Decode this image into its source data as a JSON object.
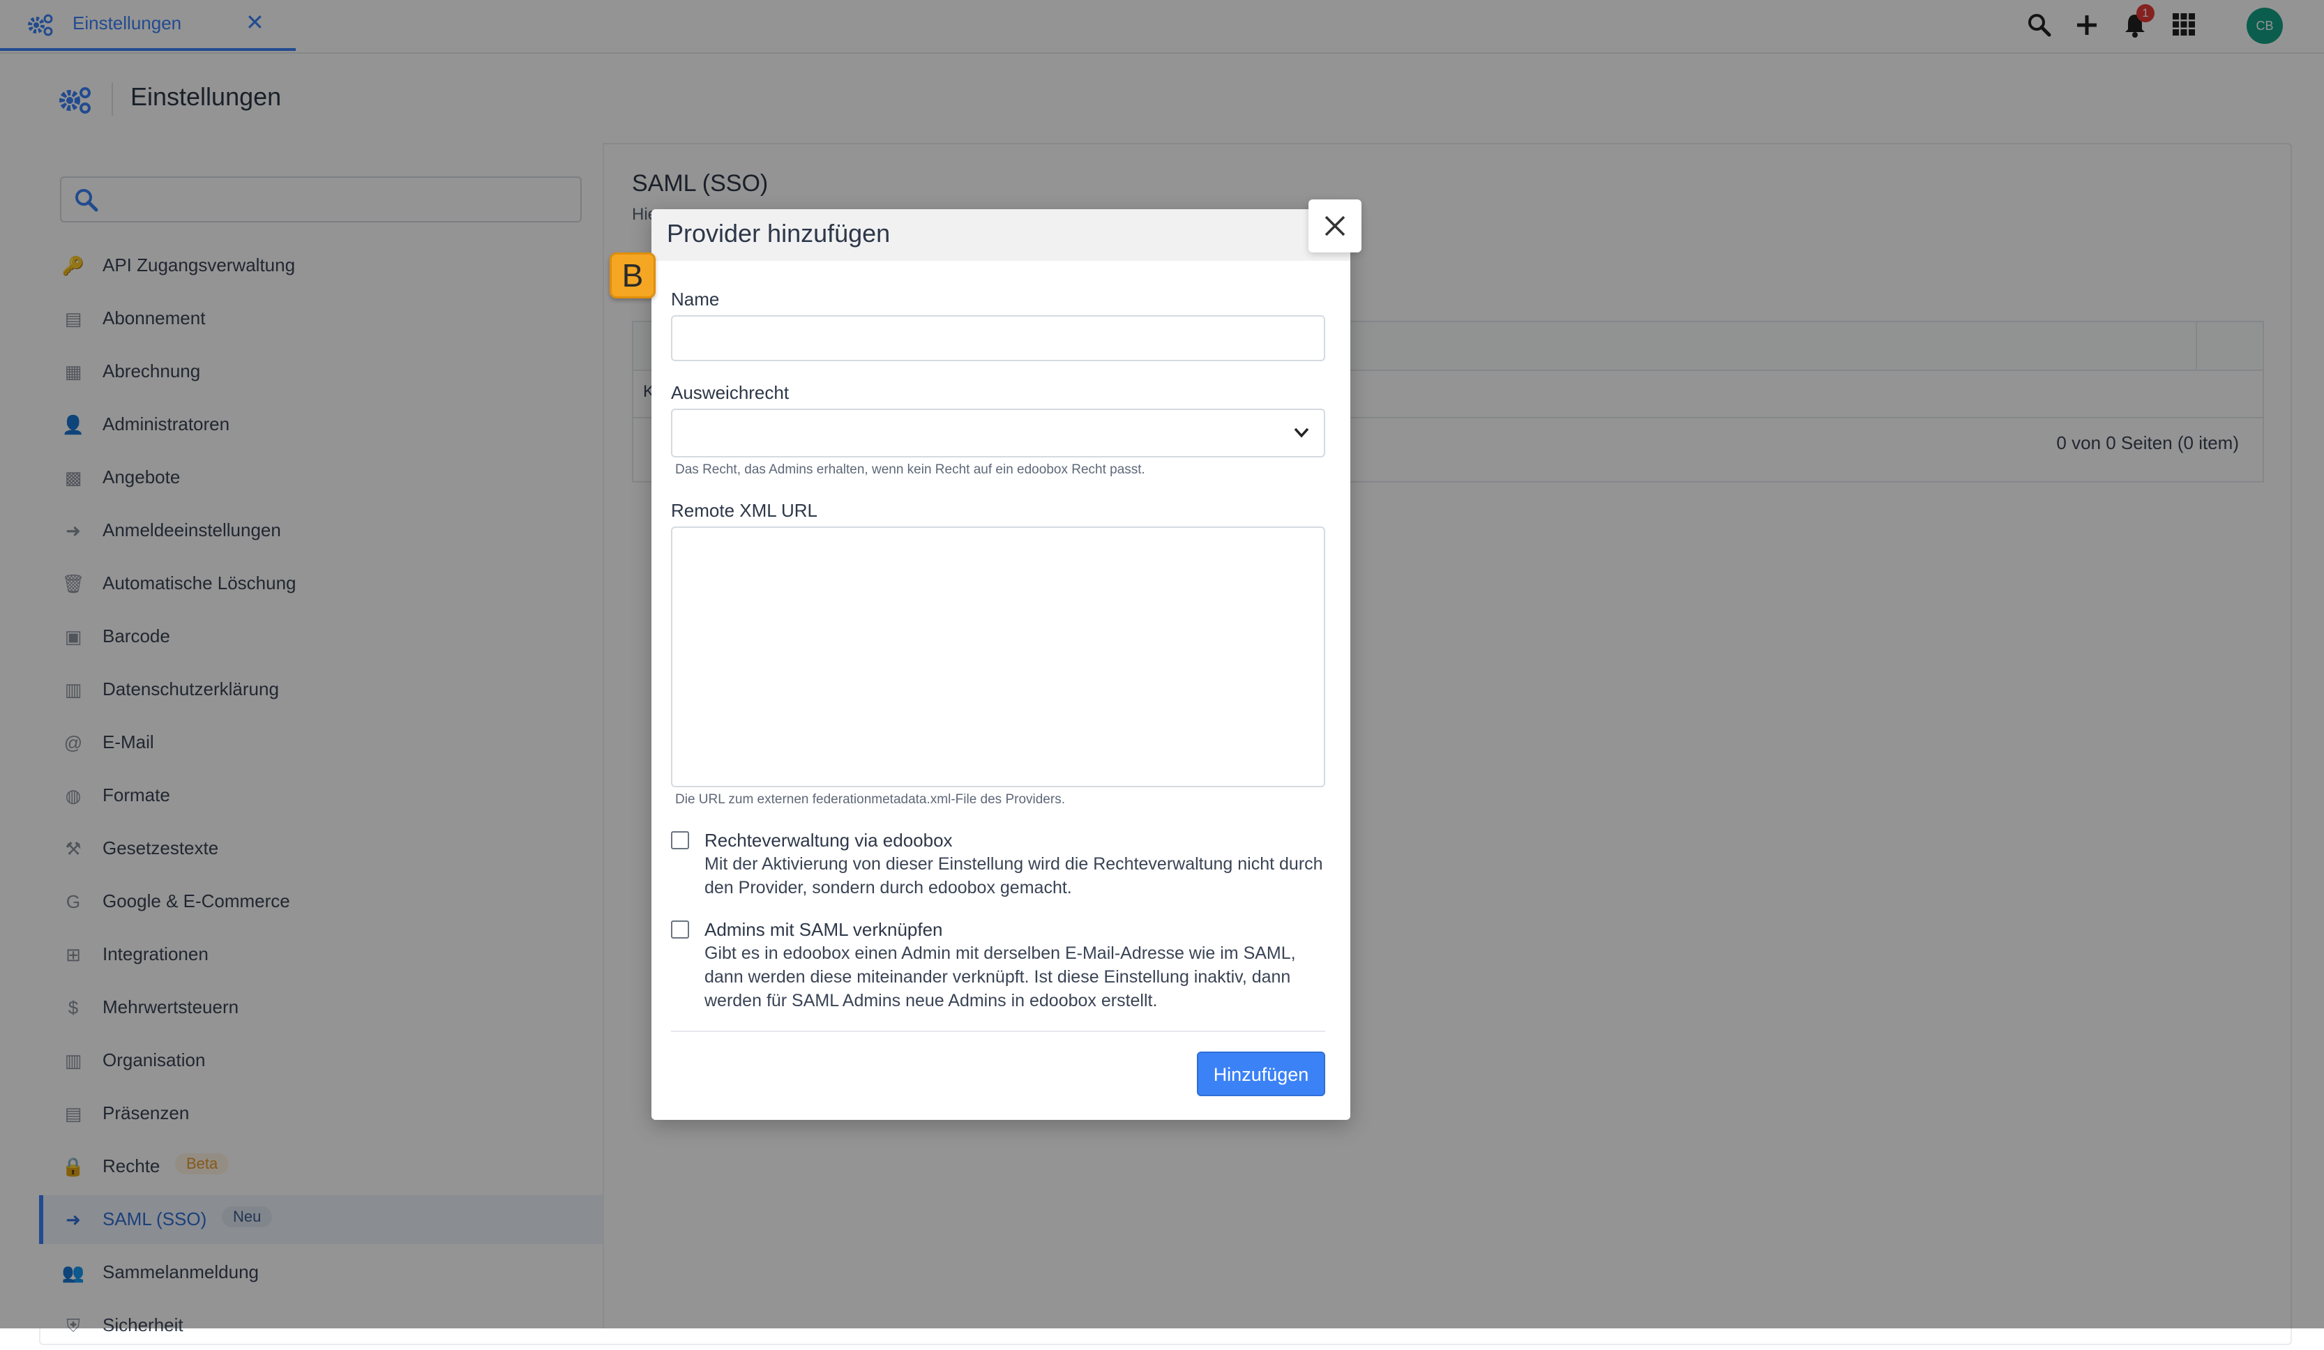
{
  "tab": {
    "label": "Einstellungen",
    "close_icon": "close-icon"
  },
  "topbar": {
    "notification_count": "1",
    "avatar_initials": "CB"
  },
  "page": {
    "title": "Einstellungen"
  },
  "sidebar": {
    "search_placeholder": "",
    "items": [
      {
        "label": "API Zugangsverwaltung",
        "icon": "key-icon"
      },
      {
        "label": "Abonnement",
        "icon": "document-icon"
      },
      {
        "label": "Abrechnung",
        "icon": "grid-icon"
      },
      {
        "label": "Administratoren",
        "icon": "user-gear-icon"
      },
      {
        "label": "Angebote",
        "icon": "boxes-icon"
      },
      {
        "label": "Anmeldeeinstellungen",
        "icon": "sign-in-icon"
      },
      {
        "label": "Automatische Löschung",
        "icon": "trash-icon"
      },
      {
        "label": "Barcode",
        "icon": "qr-icon"
      },
      {
        "label": "Datenschutzerklärung",
        "icon": "file-icon"
      },
      {
        "label": "E-Mail",
        "icon": "at-icon"
      },
      {
        "label": "Formate",
        "icon": "globe-icon"
      },
      {
        "label": "Gesetzestexte",
        "icon": "gavel-icon"
      },
      {
        "label": "Google & E-Commerce",
        "icon": "google-icon"
      },
      {
        "label": "Integrationen",
        "icon": "sitemap-icon"
      },
      {
        "label": "Mehrwertsteuern",
        "icon": "hand-dollar-icon"
      },
      {
        "label": "Organisation",
        "icon": "building-icon"
      },
      {
        "label": "Präsenzen",
        "icon": "clipboard-icon"
      },
      {
        "label": "Rechte",
        "icon": "lock-icon",
        "badge": "Beta"
      },
      {
        "label": "SAML (SSO)",
        "icon": "sign-in-icon",
        "badge": "Neu",
        "active": true
      },
      {
        "label": "Sammelanmeldung",
        "icon": "users-icon"
      },
      {
        "label": "Sicherheit",
        "icon": "shield-icon"
      }
    ]
  },
  "main": {
    "title": "SAML (SSO)",
    "subtitle": "Hie",
    "table_row_text": "K",
    "pager": "0 von 0 Seiten (0 item)"
  },
  "modal": {
    "title": "Provider hinzufügen",
    "badge_letter": "B",
    "name": {
      "label": "Name",
      "value": ""
    },
    "fallback": {
      "label": "Ausweichrecht",
      "value": "",
      "hint": "Das Recht, das Admins erhalten, wenn kein Recht auf ein edoobox Recht passt."
    },
    "xml": {
      "label": "Remote XML URL",
      "value": "",
      "hint": "Die URL zum externen federationmetadata.xml-File des Providers."
    },
    "checkbox1": {
      "title": "Rechteverwaltung via edoobox",
      "desc": "Mit der Aktivierung von dieser Einstellung wird die Rechteverwaltung nicht durch den Provider, sondern durch edoobox gemacht.",
      "checked": false
    },
    "checkbox2": {
      "title": "Admins mit SAML verknüpfen",
      "desc": "Gibt es in edoobox einen Admin mit derselben E-Mail-Adresse wie im SAML, dann werden diese miteinander verknüpft. Ist diese Einstellung inaktiv, dann werden für SAML Admins neue Admins in edoobox erstellt.",
      "checked": false
    },
    "submit_label": "Hinzufügen"
  },
  "colors": {
    "accent": "#3b82f6",
    "badge_orange": "#f5a623",
    "avatar": "#14a085",
    "notification": "#e53935"
  }
}
